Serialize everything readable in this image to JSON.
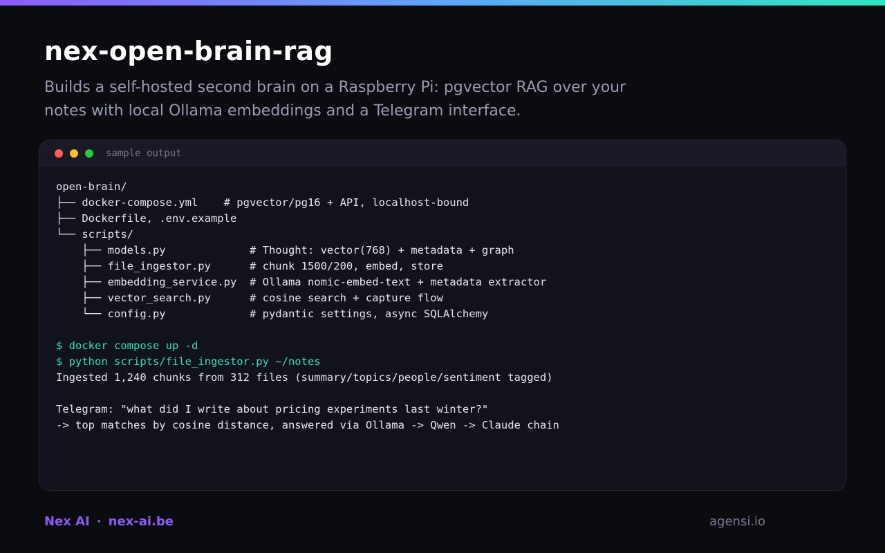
{
  "header": {
    "title": "nex-open-brain-rag",
    "subtitle": "Builds a self-hosted second brain on a Raspberry Pi: pgvector RAG over your notes with local Ollama embeddings and a Telegram interface."
  },
  "terminal": {
    "title": "sample output",
    "lines": [
      {
        "text": "open-brain/",
        "type": "output"
      },
      {
        "text": "├── docker-compose.yml    # pgvector/pg16 + API, localhost-bound",
        "type": "output"
      },
      {
        "text": "├── Dockerfile, .env.example",
        "type": "output"
      },
      {
        "text": "└── scripts/",
        "type": "output"
      },
      {
        "text": "    ├── models.py             # Thought: vector(768) + metadata + graph",
        "type": "output"
      },
      {
        "text": "    ├── file_ingestor.py      # chunk 1500/200, embed, store",
        "type": "output"
      },
      {
        "text": "    ├── embedding_service.py  # Ollama nomic-embed-text + metadata extractor",
        "type": "output"
      },
      {
        "text": "    ├── vector_search.py      # cosine search + capture flow",
        "type": "output"
      },
      {
        "text": "    └── config.py             # pydantic settings, async SQLAlchemy",
        "type": "output"
      },
      {
        "text": "",
        "type": "output"
      },
      {
        "text": "$ docker compose up -d",
        "type": "cmd"
      },
      {
        "text": "$ python scripts/file_ingestor.py ~/notes",
        "type": "cmd"
      },
      {
        "text": "Ingested 1,240 chunks from 312 files (summary/topics/people/sentiment tagged)",
        "type": "output"
      },
      {
        "text": "",
        "type": "output"
      },
      {
        "text": "Telegram: \"what did I write about pricing experiments last winter?\"",
        "type": "output"
      },
      {
        "text": "-> top matches by cosine distance, answered via Ollama -> Qwen -> Claude chain",
        "type": "output"
      }
    ]
  },
  "footer": {
    "brand": "Nex AI",
    "separator": "·",
    "site": "nex-ai.be",
    "right": "agensi.io"
  },
  "colors": {
    "background": "#0b0c10",
    "accent": "#8b5cf6",
    "command": "#34e0b8",
    "dot_red": "#ff5f57",
    "dot_yellow": "#febc2e",
    "dot_green": "#28c840"
  }
}
